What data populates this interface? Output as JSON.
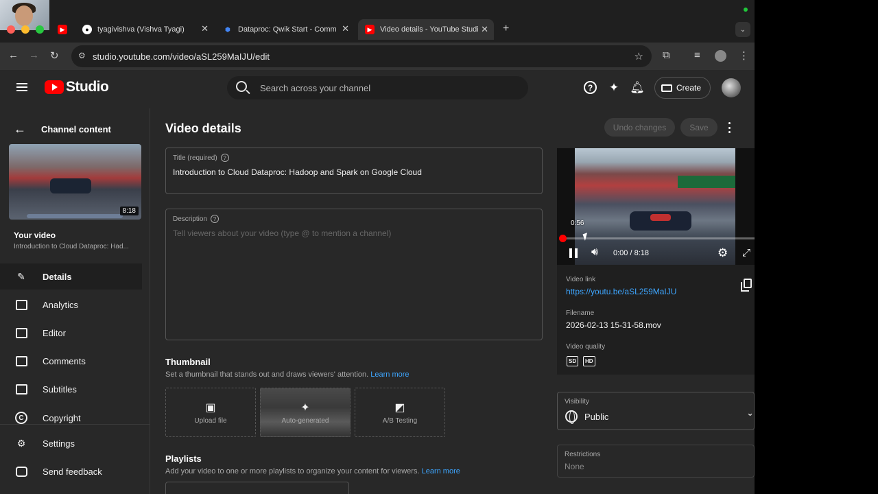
{
  "browser": {
    "tabs": [
      {
        "label": "tyagivishva (Vishva Tyagi)",
        "icon": "github-icon"
      },
      {
        "label": "Dataproc: Qwik Start - Comm",
        "icon": "cloud-icon"
      },
      {
        "label": "Video details - YouTube Studi",
        "icon": "youtube-icon"
      }
    ],
    "new_tab": "+",
    "url": "studio.youtube.com/video/aSL259MaIJU/edit"
  },
  "header": {
    "logo_text": "Studio",
    "search_placeholder": "Search across your channel",
    "create_label": "Create"
  },
  "sidebar": {
    "back_label": "Channel content",
    "thumb_duration": "8:18",
    "your_video": "Your video",
    "your_video_title": "Introduction to Cloud Dataproc: Had...",
    "items": [
      {
        "label": "Details",
        "icon": "pencil-icon",
        "active": true
      },
      {
        "label": "Analytics",
        "icon": "analytics-icon"
      },
      {
        "label": "Editor",
        "icon": "editor-icon"
      },
      {
        "label": "Comments",
        "icon": "comments-icon"
      },
      {
        "label": "Subtitles",
        "icon": "subtitles-icon"
      },
      {
        "label": "Copyright",
        "icon": "copyright-icon"
      },
      {
        "label": "Settings",
        "icon": "gear-icon"
      },
      {
        "label": "Send feedback",
        "icon": "feedback-icon"
      }
    ]
  },
  "main": {
    "title": "Video details",
    "undo_label": "Undo changes",
    "save_label": "Save",
    "title_field": {
      "label": "Title (required)",
      "value": "Introduction to Cloud Dataproc: Hadoop and Spark on Google Cloud"
    },
    "description_field": {
      "label": "Description",
      "placeholder": "Tell viewers about your video (type @ to mention a channel)"
    },
    "thumbnail": {
      "heading": "Thumbnail",
      "sub": "Set a thumbnail that stands out and draws viewers' attention.",
      "learn_more": "Learn more",
      "options": [
        "Upload file",
        "Auto-generated",
        "A/B Testing"
      ]
    },
    "playlists": {
      "heading": "Playlists",
      "sub": "Add your video to one or more playlists to organize your content for viewers.",
      "learn_more": "Learn more"
    }
  },
  "player": {
    "hover_time": "0:56",
    "time": "0:00 / 8:18",
    "progress_fraction": 0.0
  },
  "video_info": {
    "link_label": "Video link",
    "link": "https://youtu.be/aSL259MaIJU",
    "filename_label": "Filename",
    "filename": "2026-02-13 15-31-58.mov",
    "quality_label": "Video quality",
    "quality_badges": [
      "SD",
      "HD"
    ]
  },
  "visibility": {
    "label": "Visibility",
    "value": "Public"
  },
  "restrictions": {
    "label": "Restrictions",
    "value": "None"
  },
  "colors": {
    "accent": "#ff0000",
    "link": "#3ea6ff",
    "background": "#282828"
  }
}
